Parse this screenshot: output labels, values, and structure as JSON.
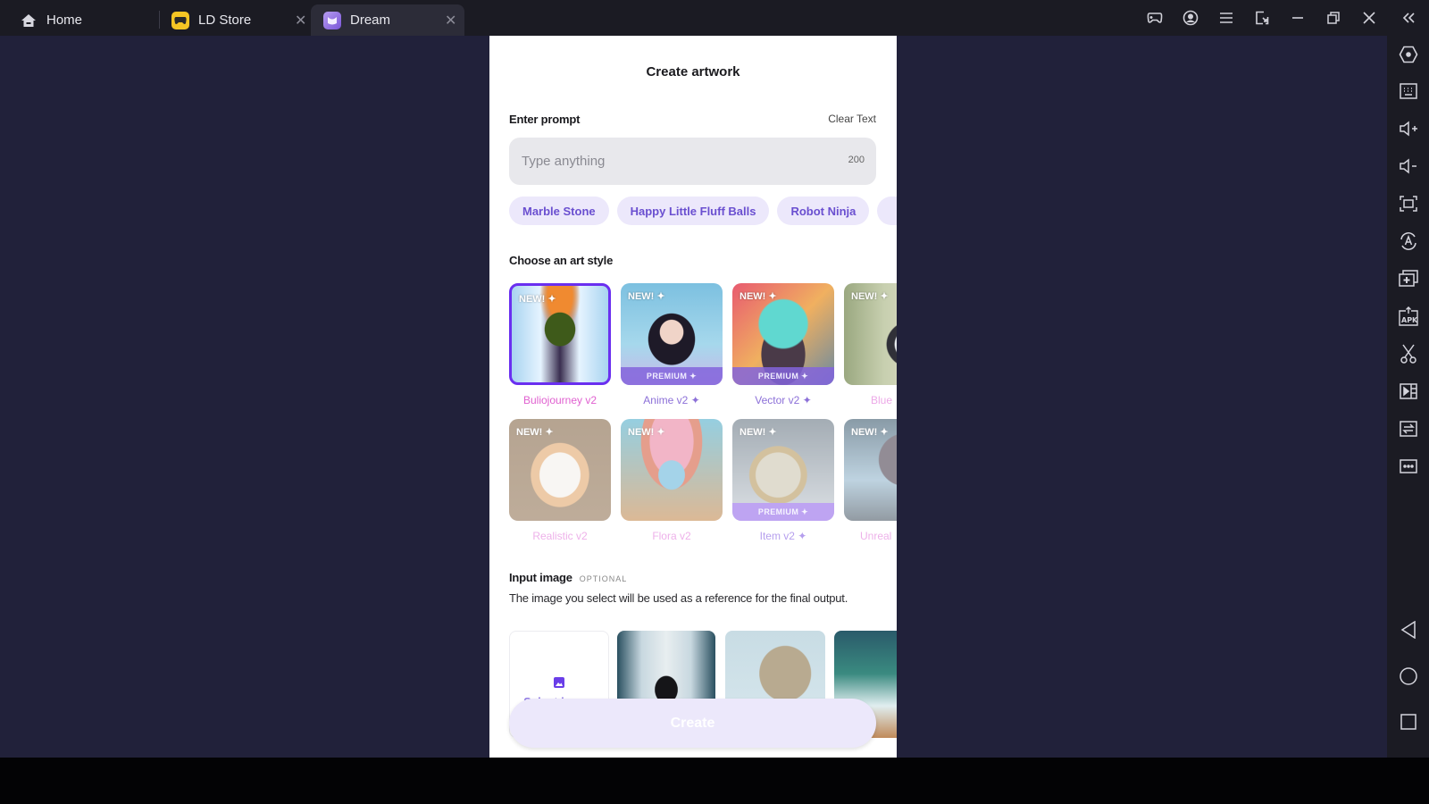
{
  "window": {
    "tabs": [
      {
        "label": "Home",
        "icon": "home-icon",
        "closable": false
      },
      {
        "label": "LD Store",
        "icon": "gamepad-icon",
        "closable": true
      },
      {
        "label": "Dream",
        "icon": "dream-app-icon",
        "closable": true,
        "active": true
      }
    ],
    "close_glyph": "✕",
    "titlebar_buttons": [
      "gamepad-icon",
      "account-icon",
      "menu-icon",
      "screen-rotate-icon",
      "minimize-icon",
      "restore-icon",
      "close-icon",
      "collapse-sidebar-icon"
    ]
  },
  "sidebar": {
    "tools": [
      "settings-hex-icon",
      "keyboard-icon",
      "volume-up-icon",
      "volume-down-icon",
      "screenshot-icon",
      "auto-rotate-icon",
      "multi-instance-icon",
      "apk-install-icon",
      "scissors-icon",
      "video-record-icon",
      "sync-icon",
      "more-icon"
    ],
    "nav": [
      "back-icon",
      "home-circle-icon",
      "recents-square-icon"
    ]
  },
  "app": {
    "title": "Create artwork",
    "prompt": {
      "label": "Enter prompt",
      "clear_label": "Clear Text",
      "placeholder": "Type anything",
      "value": "",
      "char_limit": "200"
    },
    "suggestions": [
      "Marble Stone",
      "Happy Little Fluff Balls",
      "Robot Ninja",
      ""
    ],
    "art_style": {
      "label": "Choose an art style",
      "new_badge": "NEW! ✦",
      "premium_label": "PREMIUM ✦",
      "styles": [
        {
          "name": "Buliojourney v2",
          "premium": false,
          "selected": true,
          "color": "#e060d0"
        },
        {
          "name": "Anime v2 ✦",
          "premium": true,
          "selected": false,
          "color": "#8c70d8"
        },
        {
          "name": "Vector v2 ✦",
          "premium": true,
          "selected": false,
          "color": "#8c70d8"
        },
        {
          "name": "Blue",
          "premium": false,
          "selected": false,
          "color": "#e070d8"
        },
        {
          "name": "Realistic v2",
          "premium": false,
          "selected": false,
          "color": "#e070d8"
        },
        {
          "name": "Flora v2",
          "premium": false,
          "selected": false,
          "color": "#e070d8"
        },
        {
          "name": "Item v2 ✦",
          "premium": true,
          "selected": false,
          "color": "#8c70d8"
        },
        {
          "name": "Unreal",
          "premium": false,
          "selected": false,
          "color": "#e070d8"
        }
      ]
    },
    "input_image": {
      "label": "Input image",
      "optional_label": "OPTIONAL",
      "description": "The image you select will be used as a reference for the final output.",
      "select_label": "Select image"
    },
    "create_label": "Create"
  }
}
